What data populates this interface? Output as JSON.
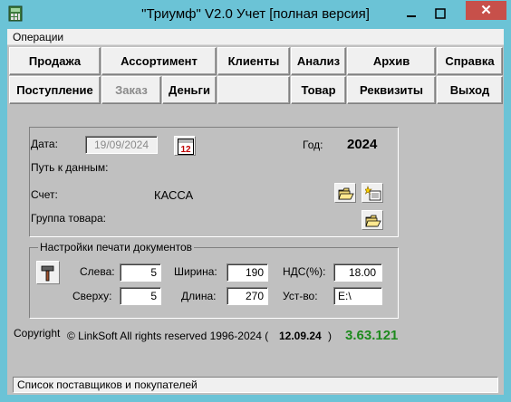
{
  "window": {
    "title": "\"Триумф\" V2.0 Учет [полная версия]",
    "close_glyph": "✕",
    "colors": {
      "title_bg": "#6bc3d6",
      "close_bg": "#c7504a",
      "body_bg": "#c0c0c0",
      "version_green": "#1e8a1e"
    }
  },
  "menu": {
    "operations": "Операции"
  },
  "toolbar": {
    "row1": {
      "sale": "Продажа",
      "assortment": "Ассортимент",
      "clients": "Клиенты",
      "analysis": "Анализ",
      "archive": "Архив",
      "help": "Справка"
    },
    "row2": {
      "receipt": "Поступление",
      "order": "Заказ",
      "money": "Деньги",
      "goods": "Товар",
      "requisites": "Реквизиты",
      "exit": "Выход"
    }
  },
  "main": {
    "date_label": "Дата:",
    "date_value": "19/09/2024",
    "calendar_icon_text": "12",
    "year_label": "Год:",
    "year_value": "2024",
    "data_path_label": "Путь к данным:",
    "account_label": "Счет:",
    "account_value": "КАССА",
    "product_group_label": "Группа товара:"
  },
  "print_settings": {
    "legend": "Настройки печати документов",
    "left_label": "Слева:",
    "left_value": "5",
    "top_label": "Сверху:",
    "top_value": "5",
    "width_label": "Ширина:",
    "width_value": "190",
    "length_label": "Длина:",
    "length_value": "270",
    "vat_label": "НДС(%):",
    "vat_value": "18.00",
    "device_label": "Уст-во:",
    "device_value": "E:\\"
  },
  "footer": {
    "copyright": "Copyright",
    "rights": "© LinkSoft All rights reserved 1996-2024 (",
    "build_date": "12.09.24",
    "close_paren": ")",
    "version": "3.63.121"
  },
  "status": {
    "text": "Список поставщиков и покупателей"
  },
  "icons": [
    "app-icon",
    "minimize-icon",
    "maximize-icon",
    "close-icon",
    "calendar-icon",
    "open-folder-icon",
    "new-item-icon",
    "hammer-icon"
  ]
}
